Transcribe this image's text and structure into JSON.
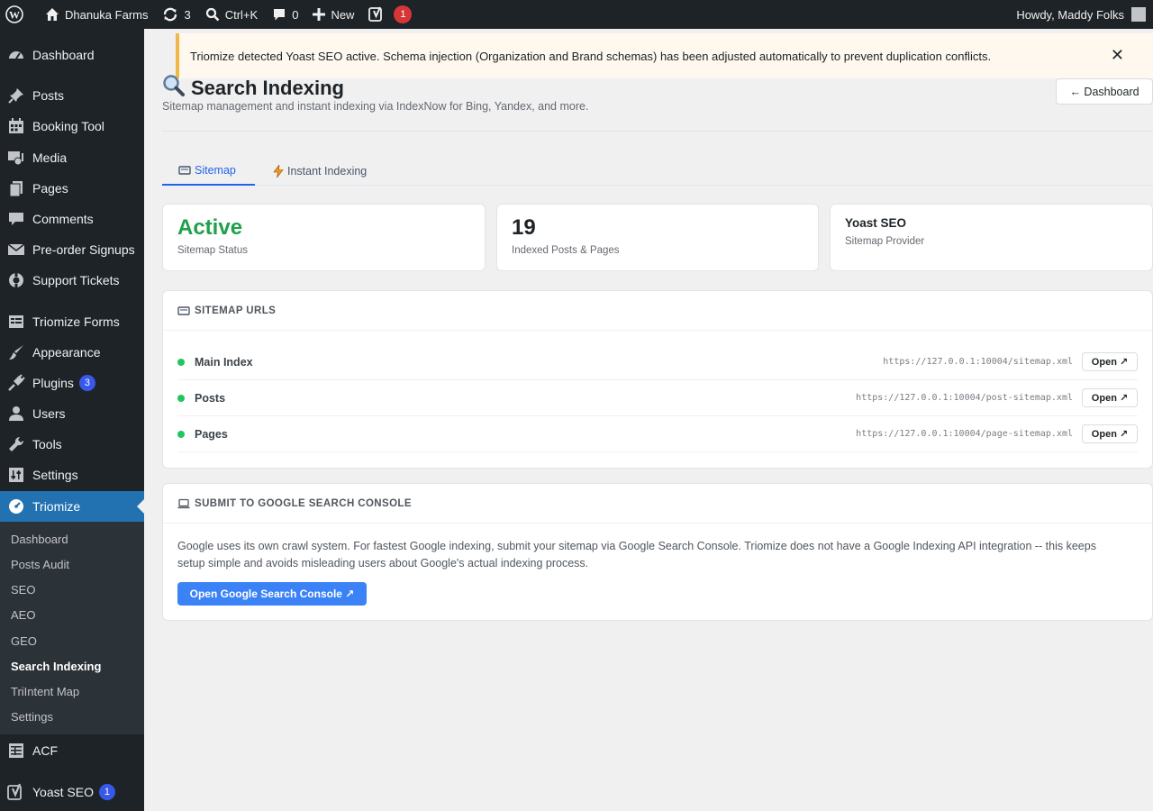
{
  "admin_bar": {
    "site_name": "Dhanuka Farms",
    "updates_count": "3",
    "search_shortcut": "Ctrl+K",
    "comments_count": "0",
    "new_label": "New",
    "yoast_count": "1",
    "greeting": "Howdy, Maddy Folks"
  },
  "sidebar": {
    "items": [
      {
        "label": "Dashboard",
        "icon": "dashboard-icon"
      },
      {
        "label": "Posts",
        "icon": "pin-icon"
      },
      {
        "label": "Booking Tool",
        "icon": "calendar-icon"
      },
      {
        "label": "Media",
        "icon": "media-icon"
      },
      {
        "label": "Pages",
        "icon": "pages-icon"
      },
      {
        "label": "Comments",
        "icon": "comment-icon"
      },
      {
        "label": "Pre-order Signups",
        "icon": "email-icon"
      },
      {
        "label": "Support Tickets",
        "icon": "lifebuoy-icon"
      },
      {
        "label": "Triomize Forms",
        "icon": "forms-icon"
      },
      {
        "label": "Appearance",
        "icon": "brush-icon"
      },
      {
        "label": "Plugins",
        "icon": "plugin-icon",
        "badge": "3"
      },
      {
        "label": "Users",
        "icon": "user-icon"
      },
      {
        "label": "Tools",
        "icon": "wrench-icon"
      },
      {
        "label": "Settings",
        "icon": "sliders-icon"
      },
      {
        "label": "Triomize",
        "icon": "gauge-icon"
      },
      {
        "label": "ACF",
        "icon": "table-icon"
      },
      {
        "label": "Yoast SEO",
        "icon": "yoast-icon",
        "badge": "1"
      }
    ],
    "submenu": [
      "Dashboard",
      "Posts Audit",
      "SEO",
      "AEO",
      "GEO",
      "Search Indexing",
      "TriIntent Map",
      "Settings"
    ]
  },
  "notice": {
    "text": "Triomize detected Yoast SEO active. Schema injection (Organization and Brand schemas) has been adjusted automatically to prevent duplication conflicts.",
    "close": "✕"
  },
  "header": {
    "title": "Search Indexing",
    "subtitle": "Sitemap management and instant indexing via IndexNow for Bing, Yandex, and more.",
    "back_button": "← Dashboard"
  },
  "tabs": [
    {
      "label": "Sitemap",
      "icon": "sitemap-icon"
    },
    {
      "label": "Instant Indexing",
      "icon": "bolt-icon"
    }
  ],
  "stats": [
    {
      "value": "Active",
      "label": "Sitemap Status",
      "color": "#1fa14b"
    },
    {
      "value": "19",
      "label": "Indexed Posts & Pages",
      "color": "#1d2327"
    },
    {
      "value": "Yoast SEO",
      "label": "Sitemap Provider",
      "color": "#1d2327"
    }
  ],
  "sitemap_urls": {
    "title": "SITEMAP URLS",
    "open_label": "Open ↗",
    "rows": [
      {
        "name": "Main Index",
        "url": "https://127.0.0.1:10004/sitemap.xml"
      },
      {
        "name": "Posts",
        "url": "https://127.0.0.1:10004/post-sitemap.xml"
      },
      {
        "name": "Pages",
        "url": "https://127.0.0.1:10004/page-sitemap.xml"
      }
    ]
  },
  "gsc": {
    "title": "SUBMIT TO GOOGLE SEARCH CONSOLE",
    "text": "Google uses its own crawl system. For fastest Google indexing, submit your sitemap via Google Search Console. Triomize does not have a Google Indexing API integration -- this keeps setup simple and avoids misleading users about Google's actual indexing process.",
    "button": "Open Google Search Console ↗"
  },
  "colors": {
    "accent": "#2563eb",
    "wp_blue": "#2271b1",
    "success": "#22c55e"
  }
}
